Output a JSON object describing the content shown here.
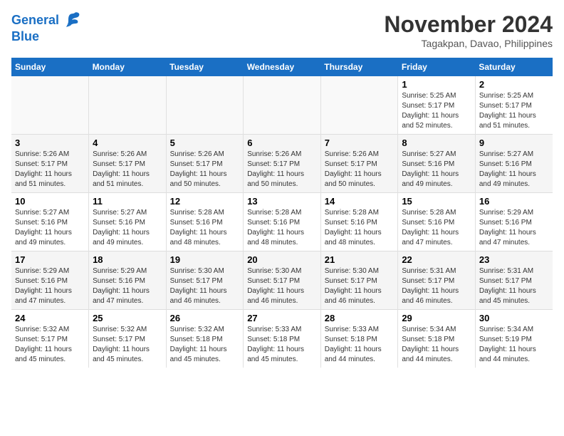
{
  "logo": {
    "line1": "General",
    "line2": "Blue"
  },
  "title": "November 2024",
  "subtitle": "Tagakpan, Davao, Philippines",
  "headers": [
    "Sunday",
    "Monday",
    "Tuesday",
    "Wednesday",
    "Thursday",
    "Friday",
    "Saturday"
  ],
  "weeks": [
    [
      {
        "num": "",
        "info": ""
      },
      {
        "num": "",
        "info": ""
      },
      {
        "num": "",
        "info": ""
      },
      {
        "num": "",
        "info": ""
      },
      {
        "num": "",
        "info": ""
      },
      {
        "num": "1",
        "info": "Sunrise: 5:25 AM\nSunset: 5:17 PM\nDaylight: 11 hours and 52 minutes."
      },
      {
        "num": "2",
        "info": "Sunrise: 5:25 AM\nSunset: 5:17 PM\nDaylight: 11 hours and 51 minutes."
      }
    ],
    [
      {
        "num": "3",
        "info": "Sunrise: 5:26 AM\nSunset: 5:17 PM\nDaylight: 11 hours and 51 minutes."
      },
      {
        "num": "4",
        "info": "Sunrise: 5:26 AM\nSunset: 5:17 PM\nDaylight: 11 hours and 51 minutes."
      },
      {
        "num": "5",
        "info": "Sunrise: 5:26 AM\nSunset: 5:17 PM\nDaylight: 11 hours and 50 minutes."
      },
      {
        "num": "6",
        "info": "Sunrise: 5:26 AM\nSunset: 5:17 PM\nDaylight: 11 hours and 50 minutes."
      },
      {
        "num": "7",
        "info": "Sunrise: 5:26 AM\nSunset: 5:17 PM\nDaylight: 11 hours and 50 minutes."
      },
      {
        "num": "8",
        "info": "Sunrise: 5:27 AM\nSunset: 5:16 PM\nDaylight: 11 hours and 49 minutes."
      },
      {
        "num": "9",
        "info": "Sunrise: 5:27 AM\nSunset: 5:16 PM\nDaylight: 11 hours and 49 minutes."
      }
    ],
    [
      {
        "num": "10",
        "info": "Sunrise: 5:27 AM\nSunset: 5:16 PM\nDaylight: 11 hours and 49 minutes."
      },
      {
        "num": "11",
        "info": "Sunrise: 5:27 AM\nSunset: 5:16 PM\nDaylight: 11 hours and 49 minutes."
      },
      {
        "num": "12",
        "info": "Sunrise: 5:28 AM\nSunset: 5:16 PM\nDaylight: 11 hours and 48 minutes."
      },
      {
        "num": "13",
        "info": "Sunrise: 5:28 AM\nSunset: 5:16 PM\nDaylight: 11 hours and 48 minutes."
      },
      {
        "num": "14",
        "info": "Sunrise: 5:28 AM\nSunset: 5:16 PM\nDaylight: 11 hours and 48 minutes."
      },
      {
        "num": "15",
        "info": "Sunrise: 5:28 AM\nSunset: 5:16 PM\nDaylight: 11 hours and 47 minutes."
      },
      {
        "num": "16",
        "info": "Sunrise: 5:29 AM\nSunset: 5:16 PM\nDaylight: 11 hours and 47 minutes."
      }
    ],
    [
      {
        "num": "17",
        "info": "Sunrise: 5:29 AM\nSunset: 5:16 PM\nDaylight: 11 hours and 47 minutes."
      },
      {
        "num": "18",
        "info": "Sunrise: 5:29 AM\nSunset: 5:16 PM\nDaylight: 11 hours and 47 minutes."
      },
      {
        "num": "19",
        "info": "Sunrise: 5:30 AM\nSunset: 5:17 PM\nDaylight: 11 hours and 46 minutes."
      },
      {
        "num": "20",
        "info": "Sunrise: 5:30 AM\nSunset: 5:17 PM\nDaylight: 11 hours and 46 minutes."
      },
      {
        "num": "21",
        "info": "Sunrise: 5:30 AM\nSunset: 5:17 PM\nDaylight: 11 hours and 46 minutes."
      },
      {
        "num": "22",
        "info": "Sunrise: 5:31 AM\nSunset: 5:17 PM\nDaylight: 11 hours and 46 minutes."
      },
      {
        "num": "23",
        "info": "Sunrise: 5:31 AM\nSunset: 5:17 PM\nDaylight: 11 hours and 45 minutes."
      }
    ],
    [
      {
        "num": "24",
        "info": "Sunrise: 5:32 AM\nSunset: 5:17 PM\nDaylight: 11 hours and 45 minutes."
      },
      {
        "num": "25",
        "info": "Sunrise: 5:32 AM\nSunset: 5:17 PM\nDaylight: 11 hours and 45 minutes."
      },
      {
        "num": "26",
        "info": "Sunrise: 5:32 AM\nSunset: 5:18 PM\nDaylight: 11 hours and 45 minutes."
      },
      {
        "num": "27",
        "info": "Sunrise: 5:33 AM\nSunset: 5:18 PM\nDaylight: 11 hours and 45 minutes."
      },
      {
        "num": "28",
        "info": "Sunrise: 5:33 AM\nSunset: 5:18 PM\nDaylight: 11 hours and 44 minutes."
      },
      {
        "num": "29",
        "info": "Sunrise: 5:34 AM\nSunset: 5:18 PM\nDaylight: 11 hours and 44 minutes."
      },
      {
        "num": "30",
        "info": "Sunrise: 5:34 AM\nSunset: 5:19 PM\nDaylight: 11 hours and 44 minutes."
      }
    ]
  ]
}
